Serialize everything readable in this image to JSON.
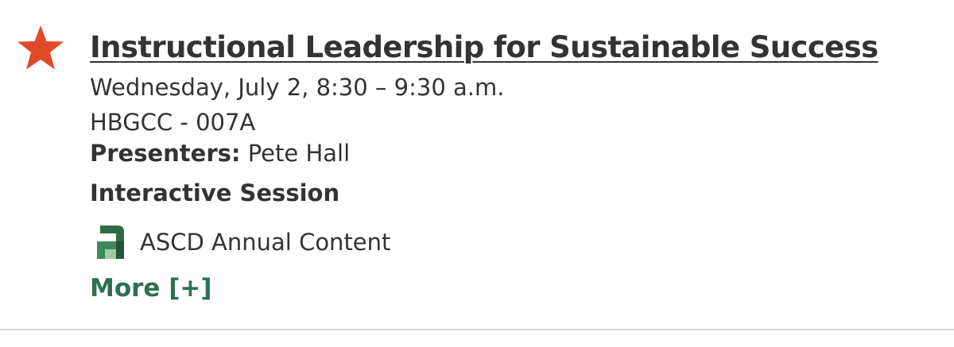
{
  "session": {
    "title": "Instructional Leadership for Sustainable Success",
    "datetime": "Wednesday, July 2, 8:30 – 9:30 a.m.",
    "room": "HBGCC - 007A",
    "presenters_label": "Presenters:",
    "presenters": "Pete Hall",
    "session_type": "Interactive Session",
    "content_tag": {
      "icon": "ascd-logo-icon",
      "label": "ASCD Annual Content"
    },
    "more_label": "More [+]"
  },
  "colors": {
    "favorite_star": "#e04a2a",
    "link_green": "#2e7050",
    "text": "#333333",
    "divider": "#d8d8d8"
  }
}
